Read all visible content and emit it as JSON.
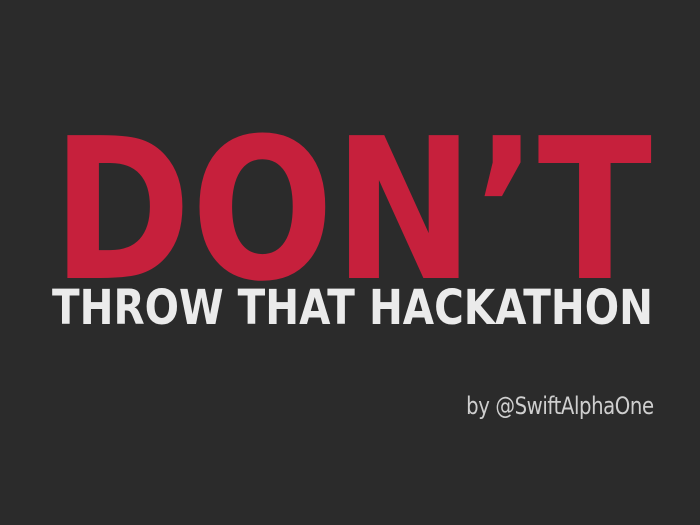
{
  "slide": {
    "headline": "DON’T",
    "subtitle": "THROW THAT HACKATHON",
    "byline": "by @SwiftAlphaOne"
  },
  "colors": {
    "background": "#2b2b2b",
    "headline": "#c6203c",
    "subtitle": "#ebebeb",
    "byline": "#cfcfcf"
  }
}
